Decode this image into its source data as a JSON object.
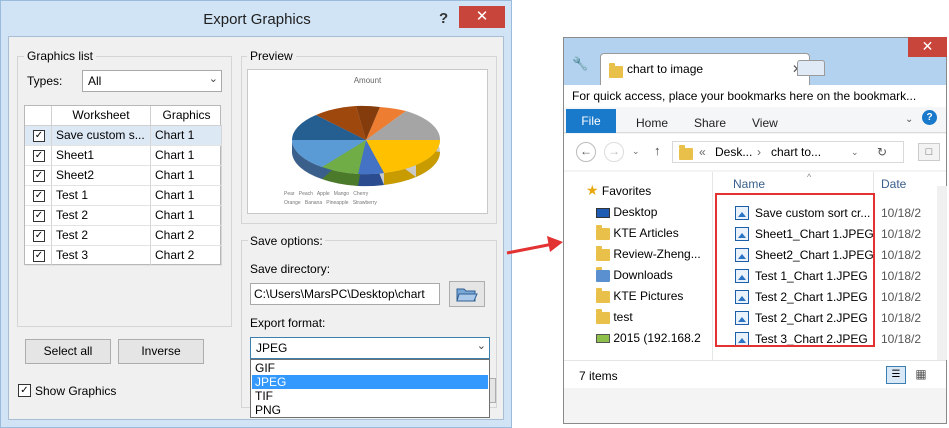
{
  "dialog": {
    "title": "Export Graphics",
    "help_label": "?",
    "close_label": "✕",
    "graphics_list": {
      "legend": "Graphics list",
      "types_label": "Types:",
      "types_value": "All",
      "columns": [
        "Worksheet",
        "Graphics"
      ],
      "rows": [
        {
          "worksheet": "Save custom s...",
          "graphics": "Chart 1",
          "checked": true
        },
        {
          "worksheet": "Sheet1",
          "graphics": "Chart 1",
          "checked": true
        },
        {
          "worksheet": "Sheet2",
          "graphics": "Chart 1",
          "checked": true
        },
        {
          "worksheet": "Test 1",
          "graphics": "Chart 1",
          "checked": true
        },
        {
          "worksheet": "Test 2",
          "graphics": "Chart 1",
          "checked": true
        },
        {
          "worksheet": "Test 2",
          "graphics": "Chart 2",
          "checked": true
        },
        {
          "worksheet": "Test 3",
          "graphics": "Chart 2",
          "checked": true
        }
      ],
      "select_all_label": "Select all",
      "inverse_label": "Inverse"
    },
    "show_graphics_label": "Show Graphics",
    "preview": {
      "legend": "Preview",
      "chart_title": "Amount",
      "legend_items": [
        "Pear",
        "Peach",
        "Apple",
        "Mango",
        "Cherry",
        "Orange",
        "Banana",
        "Pineapple",
        "Strawberry"
      ]
    },
    "save_options": {
      "legend": "Save options:",
      "directory_label": "Save directory:",
      "directory_value": "C:\\Users\\MarsPC\\Desktop\\chart",
      "format_label": "Export format:",
      "format_value": "JPEG",
      "format_options": [
        "GIF",
        "JPEG",
        "TIF",
        "PNG"
      ],
      "selected_option": "JPEG"
    }
  },
  "explorer": {
    "tab_title": "chart to image",
    "bookmark_bar_text": "For quick access, place your bookmarks here on the bookmark...",
    "ribbon_tabs": [
      "File",
      "Home",
      "Share",
      "View"
    ],
    "address": {
      "prefix": "«",
      "crumb1": "Desk...",
      "sep": "›",
      "crumb2": "chart to..."
    },
    "nav_items": [
      {
        "label": "Favorites",
        "icon": "star-icon"
      },
      {
        "label": "Desktop",
        "icon": "desktop-icon"
      },
      {
        "label": "KTE Articles",
        "icon": "folder-icon"
      },
      {
        "label": "Review-Zheng...",
        "icon": "folder-icon"
      },
      {
        "label": "Downloads",
        "icon": "downloads-icon"
      },
      {
        "label": "KTE Pictures",
        "icon": "folder-icon"
      },
      {
        "label": "test",
        "icon": "folder-icon"
      },
      {
        "label": "2015 (192.168.2",
        "icon": "network-drive-icon"
      }
    ],
    "columns": {
      "name": "Name",
      "date": "Date"
    },
    "files": [
      {
        "name": "Save custom sort cr...",
        "date": "10/18/2"
      },
      {
        "name": "Sheet1_Chart 1.JPEG",
        "date": "10/18/2"
      },
      {
        "name": "Sheet2_Chart 1.JPEG",
        "date": "10/18/2"
      },
      {
        "name": "Test 1_Chart 1.JPEG",
        "date": "10/18/2"
      },
      {
        "name": "Test 2_Chart 1.JPEG",
        "date": "10/18/2"
      },
      {
        "name": "Test 2_Chart 2.JPEG",
        "date": "10/18/2"
      },
      {
        "name": "Test 3_Chart 2.JPEG",
        "date": "10/18/2"
      }
    ],
    "status_text": "7 items",
    "colors": {
      "highlight": "#e23232",
      "file_tab": "#1979ca"
    }
  }
}
